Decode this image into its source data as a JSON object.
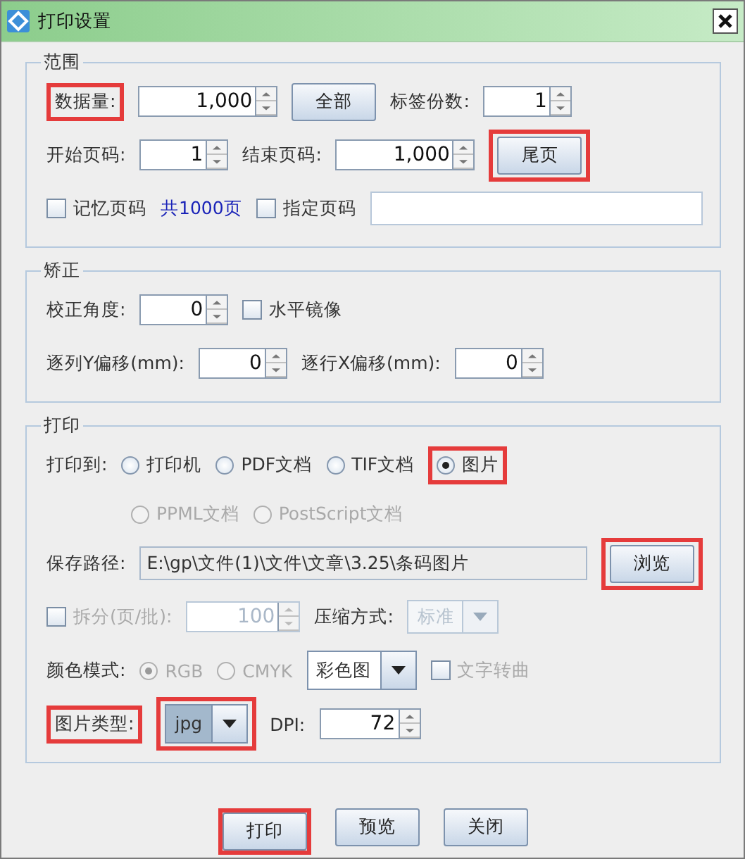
{
  "window": {
    "title": "打印设置"
  },
  "sections": [
    {
      "title": "范围",
      "rows": [
        {
          "kind": "row",
          "items": [
            {
              "kind": "label",
              "text": "数据量:",
              "highlighted": true
            },
            {
              "kind": "spinner",
              "value": "1,000"
            },
            {
              "kind": "button",
              "text": "全部"
            },
            {
              "kind": "label",
              "text": "标签份数:"
            },
            {
              "kind": "spinner",
              "value": "1"
            }
          ]
        },
        {
          "kind": "row",
          "items": [
            {
              "kind": "label",
              "text": "开始页码:"
            },
            {
              "kind": "spinner",
              "value": "1"
            },
            {
              "kind": "label",
              "text": "结束页码:"
            },
            {
              "kind": "spinner",
              "value": "1,000"
            },
            {
              "kind": "button",
              "text": "尾页",
              "highlighted": true
            }
          ]
        },
        {
          "kind": "row",
          "items": [
            {
              "kind": "checkbox",
              "text": "记忆页码",
              "checked": false
            },
            {
              "kind": "note",
              "text": "共1000页"
            },
            {
              "kind": "checkbox",
              "text": "指定页码",
              "checked": false
            },
            {
              "kind": "textfield"
            }
          ]
        }
      ]
    },
    {
      "title": "矫正",
      "rows": [
        {
          "kind": "row",
          "items": [
            {
              "kind": "label",
              "text": "校正角度:"
            },
            {
              "kind": "spinner",
              "value": "0"
            },
            {
              "kind": "checkbox",
              "text": "水平镜像",
              "checked": false
            }
          ]
        },
        {
          "kind": "row",
          "items": [
            {
              "kind": "label",
              "text": "逐列Y偏移(mm):"
            },
            {
              "kind": "spinner",
              "value": "0"
            },
            {
              "kind": "label",
              "text": "逐行X偏移(mm):"
            },
            {
              "kind": "spinner",
              "value": "0"
            }
          ]
        }
      ]
    },
    {
      "title": "打印",
      "rows": [
        {
          "kind": "row",
          "items": [
            {
              "kind": "label",
              "text": "打印到:"
            },
            {
              "kind": "radio",
              "text": "打印机",
              "selected": false
            },
            {
              "kind": "radio",
              "text": "PDF文档",
              "selected": false
            },
            {
              "kind": "radio",
              "text": "TIF文档",
              "selected": false
            },
            {
              "kind": "radio",
              "text": "图片",
              "selected": true,
              "highlighted": true
            }
          ]
        },
        {
          "kind": "continuation",
          "items": [
            {
              "kind": "radio",
              "text": "PPML文档",
              "selected": false,
              "disabled": true
            },
            {
              "kind": "radio",
              "text": "PostScript文档",
              "selected": false,
              "disabled": true
            }
          ]
        },
        {
          "kind": "row",
          "items": [
            {
              "kind": "label",
              "text": "保存路径:"
            },
            {
              "kind": "textfield",
              "value": "E:\\gp\\文件(1)\\文件\\文章\\3.25\\条码图片"
            },
            {
              "kind": "button",
              "text": "浏览",
              "highlighted": true
            }
          ]
        },
        {
          "kind": "row",
          "items": [
            {
              "kind": "checkbox",
              "text": "拆分(页/批):",
              "checked": false,
              "disabled": true
            },
            {
              "kind": "spinner",
              "value": "100",
              "disabled": true
            },
            {
              "kind": "label",
              "text": "压缩方式:"
            },
            {
              "kind": "combo",
              "value": "标准",
              "disabled": true
            }
          ]
        },
        {
          "kind": "row",
          "items": [
            {
              "kind": "label",
              "text": "颜色模式:"
            },
            {
              "kind": "radio",
              "text": "RGB",
              "selected": true,
              "disabled": true
            },
            {
              "kind": "radio",
              "text": "CMYK",
              "selected": false,
              "disabled": true
            },
            {
              "kind": "combo",
              "value": "彩色图",
              "disabled": false
            },
            {
              "kind": "checkbox",
              "text": "文字转曲",
              "checked": false,
              "disabled": true
            }
          ]
        },
        {
          "kind": "row",
          "items": [
            {
              "kind": "label",
              "text": "图片类型:",
              "highlighted": true
            },
            {
              "kind": "combo",
              "value": "jpg",
              "disabled": false,
              "focused": true,
              "highlighted": true
            },
            {
              "kind": "label",
              "text": "DPI:"
            },
            {
              "kind": "spinner",
              "value": "72"
            }
          ]
        }
      ]
    }
  ],
  "buttons": [
    {
      "text": "打印",
      "highlighted": true
    },
    {
      "text": "预览"
    },
    {
      "text": "关闭"
    }
  ]
}
